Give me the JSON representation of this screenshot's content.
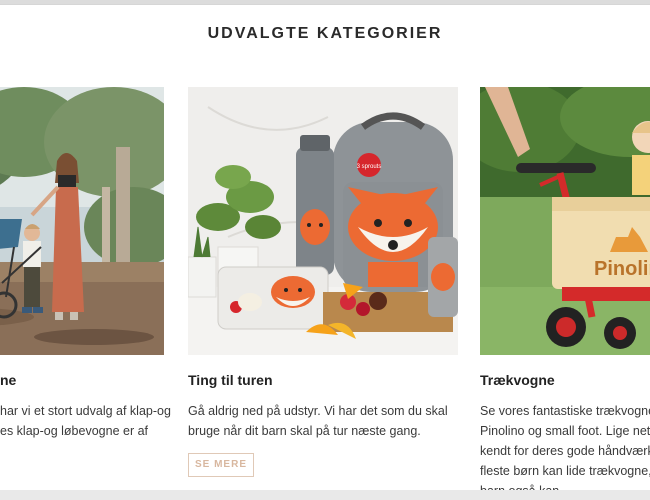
{
  "section": {
    "title": "UDVALGTE KATEGORIER"
  },
  "cards": [
    {
      "title": "ne",
      "lines": [
        "har vi et stort udvalg af klap-og",
        "es klap-og løbevogne er af"
      ]
    },
    {
      "title": "Ting til turen",
      "lines": [
        "Gå aldrig ned på udstyr. Vi har det som du skal",
        "bruge når dit barn skal på tur næste gang."
      ],
      "button": "SE MERE",
      "brand_tag": "3 sprouts"
    },
    {
      "title": "Trækvogne",
      "lines": [
        "Se vores fantastiske trækvogne a",
        "Pinolino og small foot. Lige netop",
        "kendt for deres gode håndværk o",
        "fleste børn kan lide trækvogne, s",
        "barn også kan..."
      ],
      "wagon_brand": "Pinolino"
    }
  ],
  "colors": {
    "accent": "#d8b79f",
    "fox_orange": "#ec6a33",
    "bag_grey": "#8e9397"
  }
}
